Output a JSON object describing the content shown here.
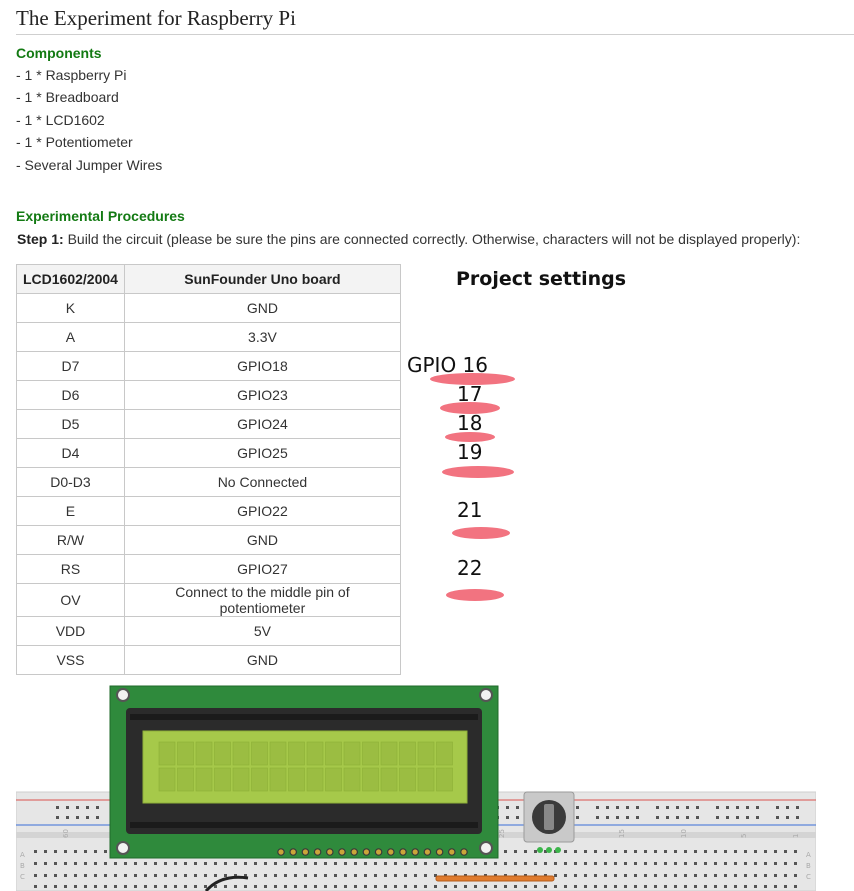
{
  "page": {
    "title": "The Experiment for Raspberry Pi"
  },
  "components": {
    "heading": "Components",
    "items": [
      "- 1 * Raspberry Pi",
      "- 1 * Breadboard",
      "- 1 * LCD1602",
      "- 1 * Potentiometer",
      "- Several Jumper Wires"
    ]
  },
  "procedures": {
    "heading": "Experimental Procedures",
    "step_label": "Step 1:",
    "step_text": " Build the circuit (please be sure the pins are connected correctly. Otherwise, characters will not be displayed properly):"
  },
  "pin_table": {
    "headers": [
      "LCD1602/2004",
      "SunFounder Uno board"
    ],
    "rows": [
      [
        "K",
        "GND"
      ],
      [
        "A",
        "3.3V"
      ],
      [
        "D7",
        "GPIO18"
      ],
      [
        "D6",
        "GPIO23"
      ],
      [
        "D5",
        "GPIO24"
      ],
      [
        "D4",
        "GPIO25"
      ],
      [
        "D0-D3",
        "No Connected"
      ],
      [
        "E",
        "GPIO22"
      ],
      [
        "R/W",
        "GND"
      ],
      [
        "RS",
        "GPIO27"
      ],
      [
        "OV",
        "Connect to the middle pin of potentiometer"
      ],
      [
        "VDD",
        "5V"
      ],
      [
        "VSS",
        "GND"
      ]
    ]
  },
  "annotations": {
    "title": "Project settings",
    "notes": [
      "GPIO 16",
      "17",
      "18",
      "19",
      "21",
      "22"
    ],
    "scribble_color": "#f05a6a"
  },
  "illustration": {
    "breadboard_numbers": [
      "60",
      "25",
      "20",
      "15",
      "10",
      "5",
      "1"
    ],
    "breadboard_letters": [
      "A",
      "B",
      "C"
    ],
    "lcd_color": "#2f8a3c",
    "screen_color": "#a6c94a"
  }
}
